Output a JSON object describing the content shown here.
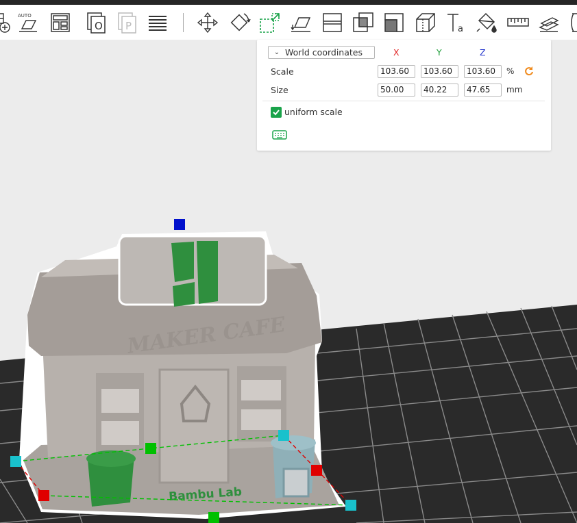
{
  "toolbar": {
    "tools": [
      {
        "name": "add-plate-icon"
      },
      {
        "name": "auto-orient-icon",
        "label": "AUTO"
      },
      {
        "name": "arrange-icon"
      },
      {
        "name": "split-objects-icon",
        "label": "O"
      },
      {
        "name": "split-parts-icon",
        "label": "P"
      },
      {
        "name": "variable-layer-height-icon"
      },
      {
        "name": "move-icon"
      },
      {
        "name": "rotate-icon"
      },
      {
        "name": "scale-icon"
      },
      {
        "name": "lay-on-face-icon"
      },
      {
        "name": "cut-icon"
      },
      {
        "name": "boolean-icon"
      },
      {
        "name": "support-paint-icon"
      },
      {
        "name": "seam-paint-icon"
      },
      {
        "name": "text-emboss-icon",
        "label": "a"
      },
      {
        "name": "color-paint-icon"
      },
      {
        "name": "measure-icon"
      },
      {
        "name": "assembly-icon"
      },
      {
        "name": "more-icon"
      }
    ]
  },
  "scale_panel": {
    "coordinate_mode": "World coordinates",
    "axes": {
      "x": "X",
      "y": "Y",
      "z": "Z"
    },
    "axis_colors": {
      "x": "#e02020",
      "y": "#1f9e3a",
      "z": "#2233cc"
    },
    "scale": {
      "label": "Scale",
      "x": "103.60",
      "y": "103.60",
      "z": "103.60",
      "unit": "%"
    },
    "size": {
      "label": "Size",
      "x": "50.00",
      "y": "40.22",
      "z": "47.65",
      "unit": "mm"
    },
    "uniform_scale": {
      "label": "uniform scale",
      "checked": true
    },
    "reset_icon": "reset-rotate-icon",
    "keyboard_icon": "keyboard-icon"
  },
  "model": {
    "sign_text": "MAKER CAFE",
    "base_text": "Bambu Lab"
  },
  "colors": {
    "accent": "#1aa34a",
    "model_body": "#b0aaa5",
    "model_green": "#2f8f3e",
    "bed": "#2a2a2a",
    "handle_cyan": "#19c1cc",
    "handle_red": "#e00000",
    "handle_green": "#00c000",
    "handle_blue": "#0010cc"
  }
}
